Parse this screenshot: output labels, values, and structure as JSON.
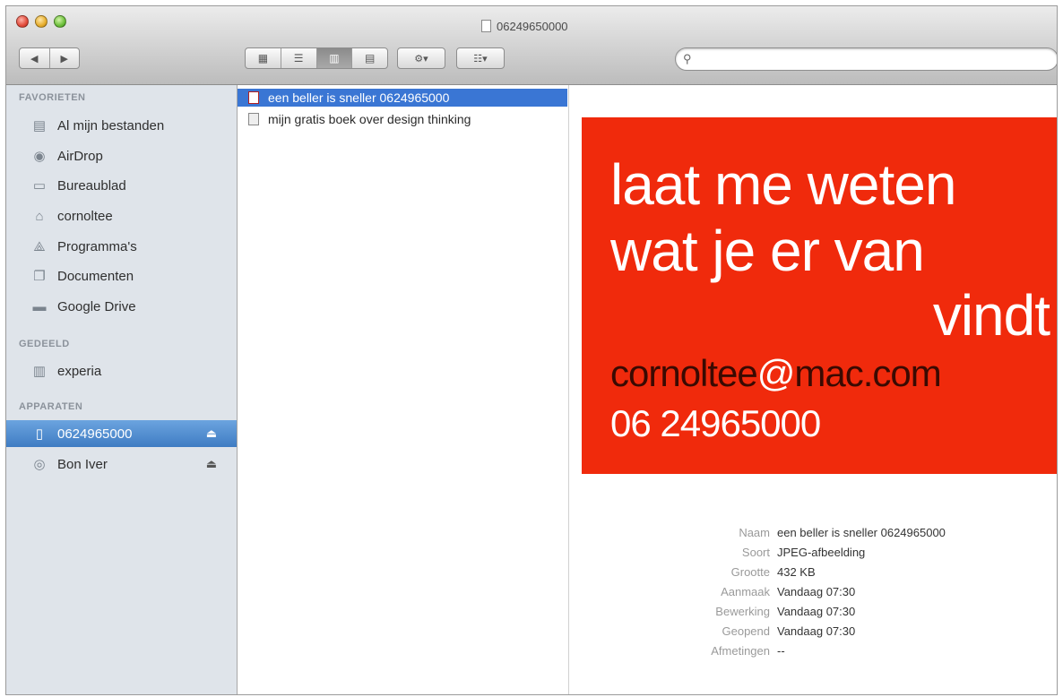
{
  "window": {
    "title": "06249650000"
  },
  "toolbar": {
    "back_label": "◀",
    "forward_label": "▶",
    "view_icons": [
      "▦",
      "☰",
      "▥",
      "▤"
    ],
    "action_label": "⚙▾",
    "arrange_label": "☷▾",
    "search_placeholder": ""
  },
  "sidebar": {
    "favorites_header": "FAVORIETEN",
    "favorites": [
      {
        "label": "Al mijn bestanden",
        "icon": "all-files-icon"
      },
      {
        "label": "AirDrop",
        "icon": "airdrop-icon"
      },
      {
        "label": "Bureaublad",
        "icon": "desktop-icon"
      },
      {
        "label": "cornoltee",
        "icon": "home-icon"
      },
      {
        "label": "Programma's",
        "icon": "applications-icon"
      },
      {
        "label": "Documenten",
        "icon": "documents-icon"
      },
      {
        "label": "Google Drive",
        "icon": "folder-icon"
      }
    ],
    "shared_header": "GEDEELD",
    "shared": [
      {
        "label": "experia",
        "icon": "server-icon"
      }
    ],
    "devices_header": "APPARATEN",
    "devices": [
      {
        "label": "0624965000",
        "icon": "phone-icon",
        "selected": true
      },
      {
        "label": "Bon Iver",
        "icon": "disc-icon",
        "selected": false
      }
    ],
    "eject_glyph": "⏏"
  },
  "files": [
    {
      "name": "een beller is sneller 0624965000",
      "type": "jpg",
      "selected": true
    },
    {
      "name": "mijn gratis boek over design thinking",
      "type": "pdf",
      "selected": false
    }
  ],
  "preview": {
    "image_lines": [
      "laat me weten",
      "wat je er van",
      "vindt"
    ],
    "email_prefix": "cornoltee",
    "email_at": "@",
    "email_suffix": "mac.com",
    "phone": "06 24965000",
    "background_color": "#f02a0c",
    "info": [
      {
        "label": "Naam",
        "value": "een beller is sneller 0624965000"
      },
      {
        "label": "Soort",
        "value": "JPEG-afbeelding"
      },
      {
        "label": "Grootte",
        "value": "432 KB"
      },
      {
        "label": "Aanmaak",
        "value": "Vandaag 07:30"
      },
      {
        "label": "Bewerking",
        "value": "Vandaag 07:30"
      },
      {
        "label": "Geopend",
        "value": "Vandaag 07:30"
      },
      {
        "label": "Afmetingen",
        "value": "--"
      }
    ]
  }
}
